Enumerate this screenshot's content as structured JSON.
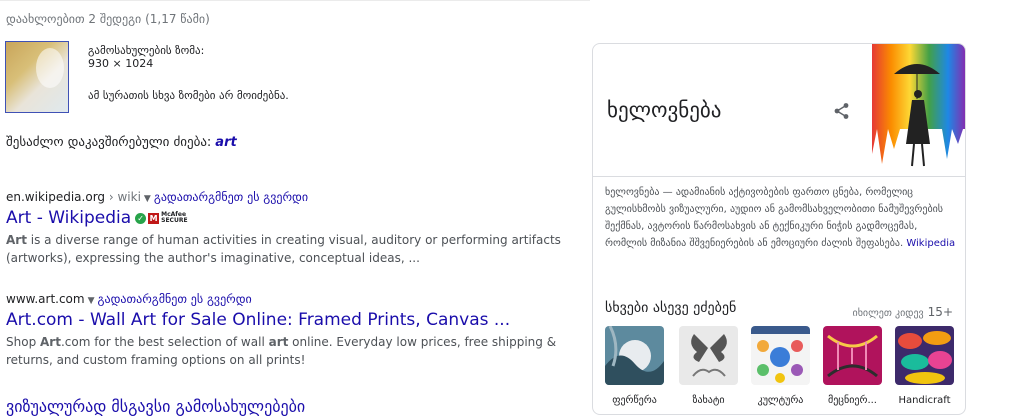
{
  "results_stats": "დაახლოებით 2 შედეგი (1,17 წამი)",
  "image_info": {
    "size_label": "გამოსახულების ზომა:",
    "size_value": "930 × 1024",
    "note": "ამ სურათის სხვა ზომები არ მოიძებნა."
  },
  "best_guess": {
    "label": "შესაძლო დაკავშირებული ძიება:",
    "query": "art"
  },
  "results": [
    {
      "site": "en.wikipedia.org",
      "path": "wiki",
      "translate": "გადათარგმნეთ ეს გვერდი",
      "title": "Art - Wikipedia",
      "badge_text_1": "McAfee",
      "badge_text_2": "SECURE",
      "snippet_bold": "Art",
      "snippet_line1": " is a diverse range of human activities in creating visual, auditory or performing artifacts",
      "snippet_line2": "(artworks), expressing the author's imaginative, conceptual ideas, ..."
    },
    {
      "site": "www.art.com",
      "translate": "გადათარგმნეთ ეს გვერდი",
      "title": "Art.com - Wall Art for Sale Online: Framed Prints, Canvas ...",
      "snippet_a": "Shop ",
      "snippet_bold1": "Art",
      "snippet_b": ".com for the best selection of wall ",
      "snippet_bold2": "art",
      "snippet_c": " online. Everyday low prices, free shipping &",
      "snippet_line2": "returns, and custom framing options on all prints!"
    }
  ],
  "similar_images": "ვიზუალურად მსგავსი გამოსახულებები",
  "knowledge_panel": {
    "title": "ხელოვნება",
    "description": "ხელოვნება — ადამიანის აქტივობების ფართო ცნება, რომელიც გულისხმობს ვიზუალური, აუდიო ან გამომსახველობითი ნამუშევრების შექმნას, ავტორის წარმოსახვის ან ტექნიკური ნიჭის გადმოცემას, რომლის მიზანია შშვენიერების ან ემოციური ძალის შეფასება.",
    "source": "Wikipedia",
    "also_search": "სხვები ასევე ეძებენ",
    "view_more": "იხილეთ კიდევ",
    "more_count": "15+",
    "tiles": [
      {
        "label": "ფერწერა",
        "icon": "painting-thumbnail"
      },
      {
        "label": "ზახატი",
        "icon": "butterfly-thumbnail"
      },
      {
        "label": "კულტურა",
        "icon": "culture-thumbnail"
      },
      {
        "label": "მეცნიერ...",
        "icon": "dna-thumbnail"
      },
      {
        "label": "Handicraft",
        "icon": "handicraft-thumbnail"
      }
    ]
  },
  "colors": {
    "link": "#1a0dab",
    "text": "#202124",
    "muted": "#70757a"
  }
}
